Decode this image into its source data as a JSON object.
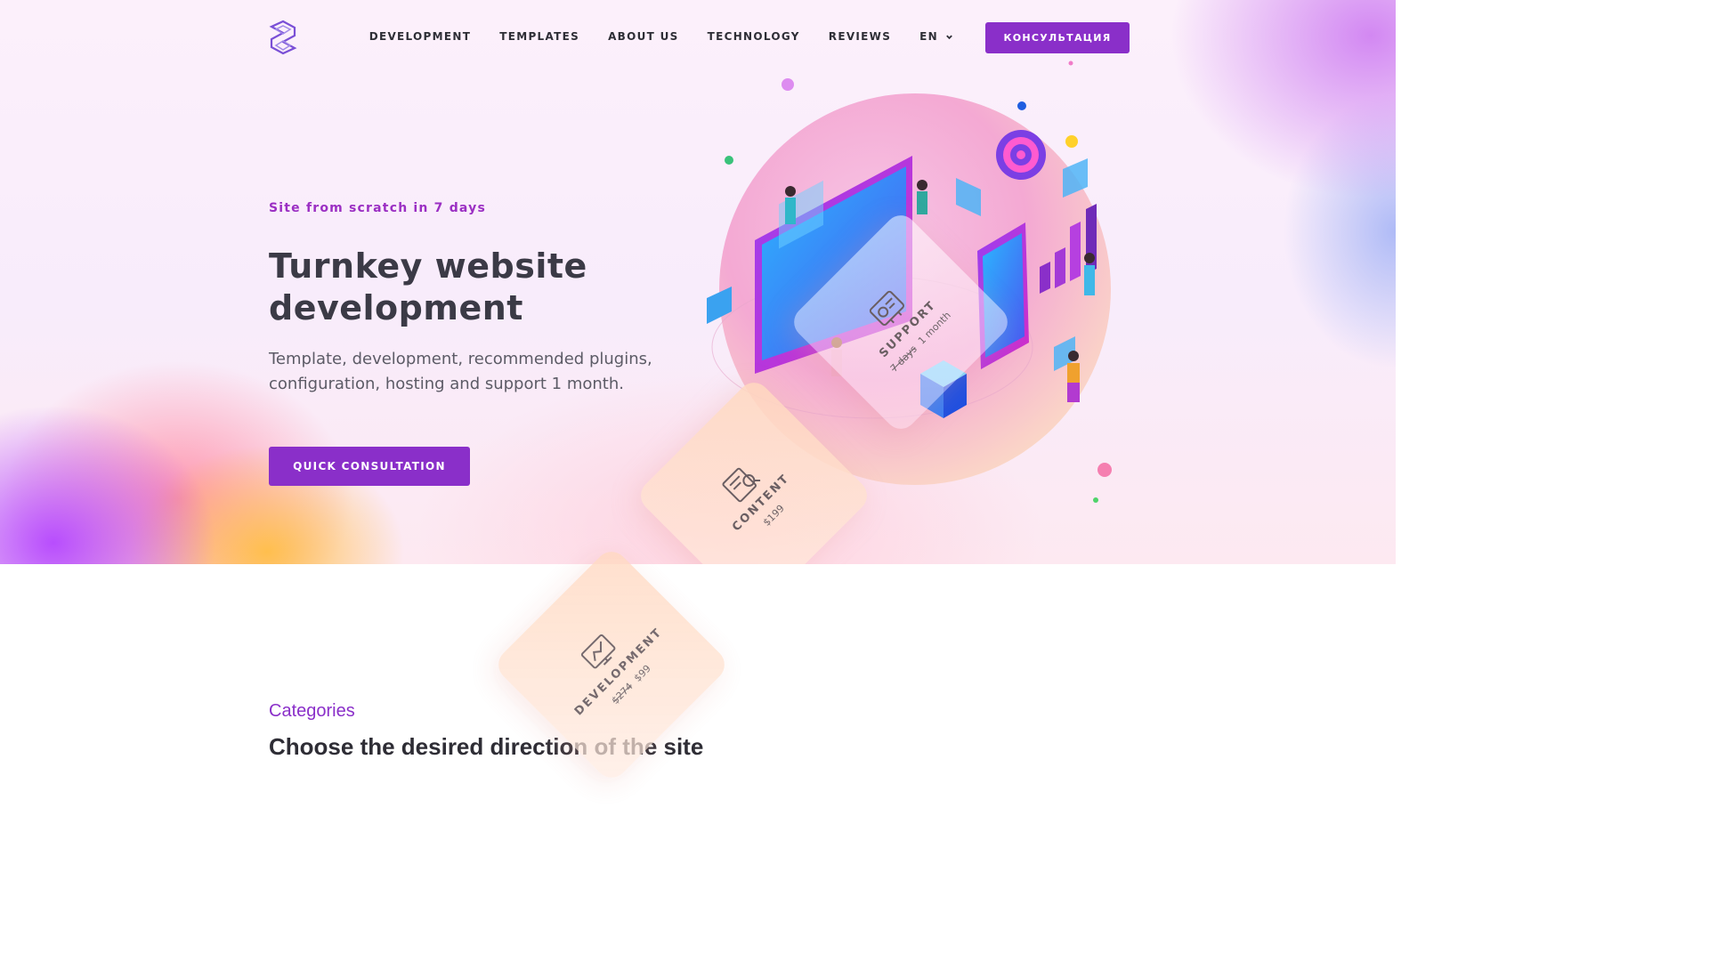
{
  "nav": {
    "logo": "s-logo-icon",
    "links": [
      {
        "label": "DEVELOPMENT"
      },
      {
        "label": "TEMPLATES"
      },
      {
        "label": "ABOUT US"
      },
      {
        "label": "TECHNOLOGY"
      },
      {
        "label": "REVIEWS"
      }
    ],
    "language": "EN",
    "consult_button": "КОНСУЛЬТАЦИЯ"
  },
  "hero": {
    "eyebrow": "Site from scratch in 7 days",
    "headline": "Turnkey website development",
    "subtext": "Template, development, recommended plugins, configuration, hosting and support 1 month.",
    "cta": "QUICK CONSULTATION",
    "illustration": "isometric-web-development-illustration"
  },
  "cards": {
    "support": {
      "label": "SUPPORT",
      "old_value": "7 days",
      "value": "1 month",
      "icon": "support-icon"
    },
    "content": {
      "label": "CONTENT",
      "value": "$199",
      "icon": "content-icon"
    },
    "development": {
      "label": "DEVELOPMENT",
      "old_value": "$274",
      "value": "$99",
      "icon": "development-icon"
    }
  },
  "categories": {
    "label": "Categories",
    "title": "Choose the desired direction of the site"
  },
  "colors": {
    "accent": "#8a2fc9",
    "heading": "#3b3a46",
    "eyebrow": "#9b2fc3"
  }
}
